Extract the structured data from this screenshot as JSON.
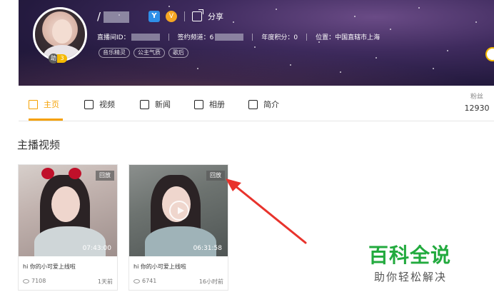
{
  "profile": {
    "name_visible": "/",
    "share_label": "分享",
    "vip_badge": "Y",
    "v_badge": "V",
    "room_id_label": "直播间ID：",
    "channel_label": "签约频道：6",
    "annual_points": "年度积分：0",
    "location": "位置：中国直辖市上海",
    "tags": [
      "音乐精灵",
      "公主气质",
      "歌后"
    ],
    "level_left": "助",
    "level_right": "3"
  },
  "tabs": [
    {
      "label": "主页",
      "icon": "home-icon",
      "active": true
    },
    {
      "label": "视频",
      "icon": "video-icon",
      "active": false
    },
    {
      "label": "新闻",
      "icon": "news-icon",
      "active": false
    },
    {
      "label": "相册",
      "icon": "album-icon",
      "active": false
    },
    {
      "label": "简介",
      "icon": "intro-icon",
      "active": false
    }
  ],
  "fans": {
    "label": "粉丝",
    "value": "12930"
  },
  "section": {
    "title": "主播视频"
  },
  "videos": [
    {
      "badge": "回放",
      "duration": "07:43:00",
      "title": "hi 你的小可爱上线啦",
      "views": "7108",
      "time": "1天前"
    },
    {
      "badge": "回放",
      "duration": "06:31:58",
      "title": "hi 你的小可爱上线啦",
      "views": "6741",
      "time": "16小时前"
    }
  ],
  "watermark": {
    "title": "百科全说",
    "subtitle": "助你轻松解决"
  },
  "colors": {
    "accent": "#f5a000",
    "watermark_green": "#22aa3e",
    "arrow_red": "#e8332c"
  }
}
